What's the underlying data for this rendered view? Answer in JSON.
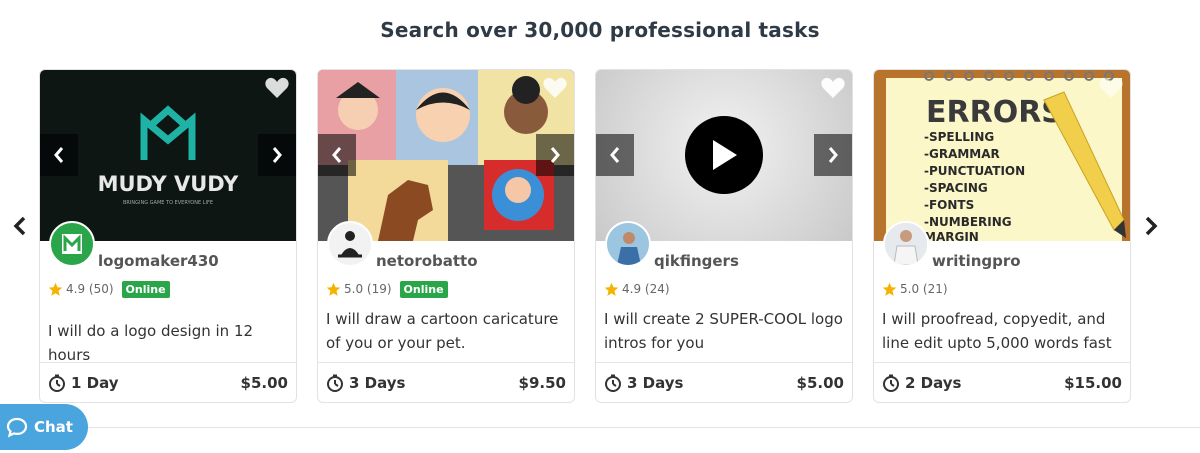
{
  "header": {
    "title": "Search over 30,000 professional tasks"
  },
  "carousel": {
    "prev_icon": "chevron-left-icon",
    "next_icon": "chevron-right-icon"
  },
  "cards": [
    {
      "seller": "logomaker430",
      "rating": "4.9 (50)",
      "online": "Online",
      "description": "I will do a logo design in 12 hours",
      "delivery": "1 Day",
      "price": "$5.00",
      "thumb_text": "MUDY VUDY",
      "thumb_subtext": "BRINGING GAME TO EVERYONE LIFE",
      "accent": "#1fb3a5"
    },
    {
      "seller": "netorobatto",
      "rating": "5.0 (19)",
      "online": "Online",
      "description": "I will draw a cartoon caricature of you or your pet.",
      "delivery": "3 Days",
      "price": "$9.50"
    },
    {
      "seller": "qikfingers",
      "rating": "4.9 (24)",
      "description": "I will create 2 SUPER-COOL logo intros for you",
      "delivery": "3 Days",
      "price": "$5.00"
    },
    {
      "seller": "writingpro",
      "rating": "5.0 (21)",
      "description": "I will proofread, copyedit, and line edit upto 5,000 words fast",
      "delivery": "2 Days",
      "price": "$15.00",
      "thumb_title": "ERRORS",
      "thumb_lines": [
        "-SPELLING",
        "-GRAMMAR",
        "-PUNCTUATION",
        "-SPACING",
        "-FONTS",
        "-NUMBERING",
        "MARGIN"
      ]
    }
  ],
  "chat": {
    "label": "Chat"
  },
  "colors": {
    "online_badge": "#2aa54a",
    "chat_bg": "#4aa4dd",
    "star": "#f5b301"
  }
}
